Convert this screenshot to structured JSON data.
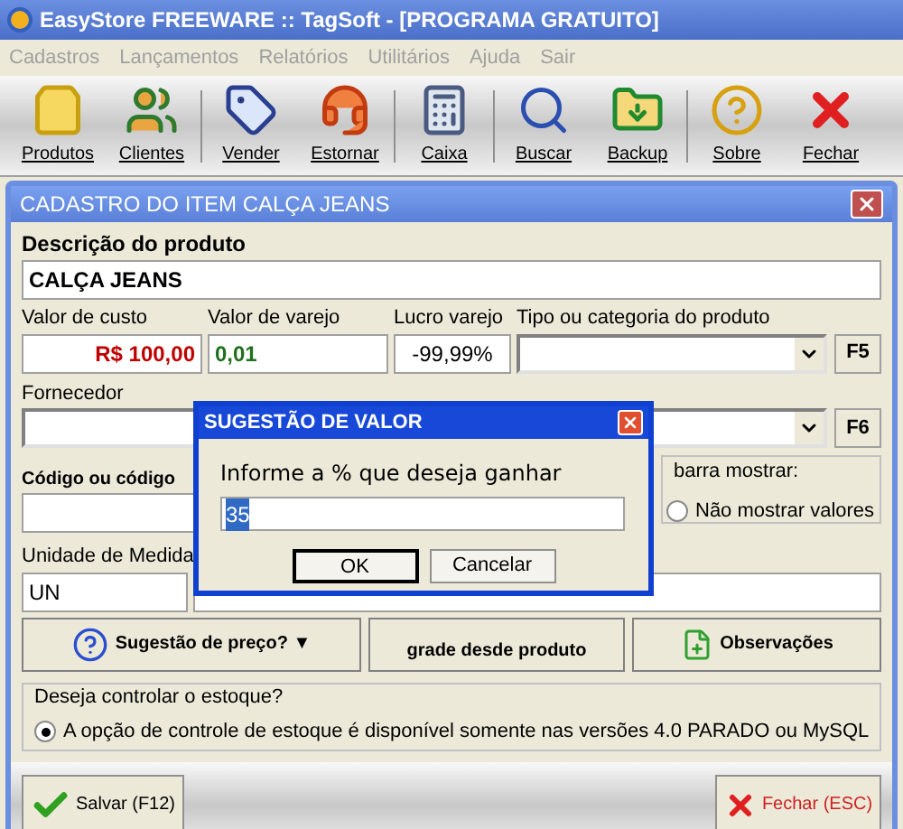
{
  "window": {
    "title": "EasyStore FREEWARE :: TagSoft -  [PROGRAMA GRATUITO]"
  },
  "menu": [
    "Cadastros",
    "Lançamentos",
    "Relatórios",
    "Utilitários",
    "Ajuda",
    "Sair"
  ],
  "toolbar": [
    {
      "label": "Produtos",
      "separator_after": false
    },
    {
      "label": "Clientes",
      "separator_after": true
    },
    {
      "label": "Vender",
      "separator_after": false
    },
    {
      "label": "Estornar",
      "separator_after": true
    },
    {
      "label": "Caixa",
      "separator_after": true
    },
    {
      "label": "Buscar",
      "separator_after": false
    },
    {
      "label": "Backup",
      "separator_after": true
    },
    {
      "label": "Sobre",
      "separator_after": false
    },
    {
      "label": "Fechar",
      "separator_after": false
    }
  ],
  "form": {
    "title": "CADASTRO DO ITEM CALÇA JEANS",
    "description_label": "Descrição do produto",
    "description_value": "CALÇA JEANS",
    "cost_label": "Valor de custo",
    "cost_value": "R$ 100,00",
    "retail_label": "Valor de varejo",
    "retail_value": "0,01",
    "profit_label": "Lucro varejo",
    "profit_value": "-99,99%",
    "category_label": "Tipo ou categoria do produto",
    "category_key": "F5",
    "supplier_label": "Fornecedor",
    "supplier_key": "F6",
    "code_label": "Código ou código",
    "barcode_group_label": "barra mostrar:",
    "barcode_option": {
      "label": "Não mostrar valores",
      "selected": false
    },
    "unit_label": "Unidade de Medida",
    "unit_value": "UN",
    "price_button": "Sugestão de preço? ▼",
    "grid_button": "grade desde produto",
    "notes_button": "Observações",
    "stock_group_label": "Deseja controlar o estoque?",
    "stock_option": {
      "label": "A opção de controle de estoque é disponível somente nas versões 4.0 PARADO ou MySQL",
      "selected": true
    },
    "save_button": "Salvar (F12)",
    "close_button": "Fechar (ESC)"
  },
  "dialog": {
    "title": "SUGESTÃO DE VALOR",
    "prompt": "Informe a % que deseja ganhar",
    "value": "35",
    "buttons": [
      "OK",
      "Cancelar"
    ]
  }
}
